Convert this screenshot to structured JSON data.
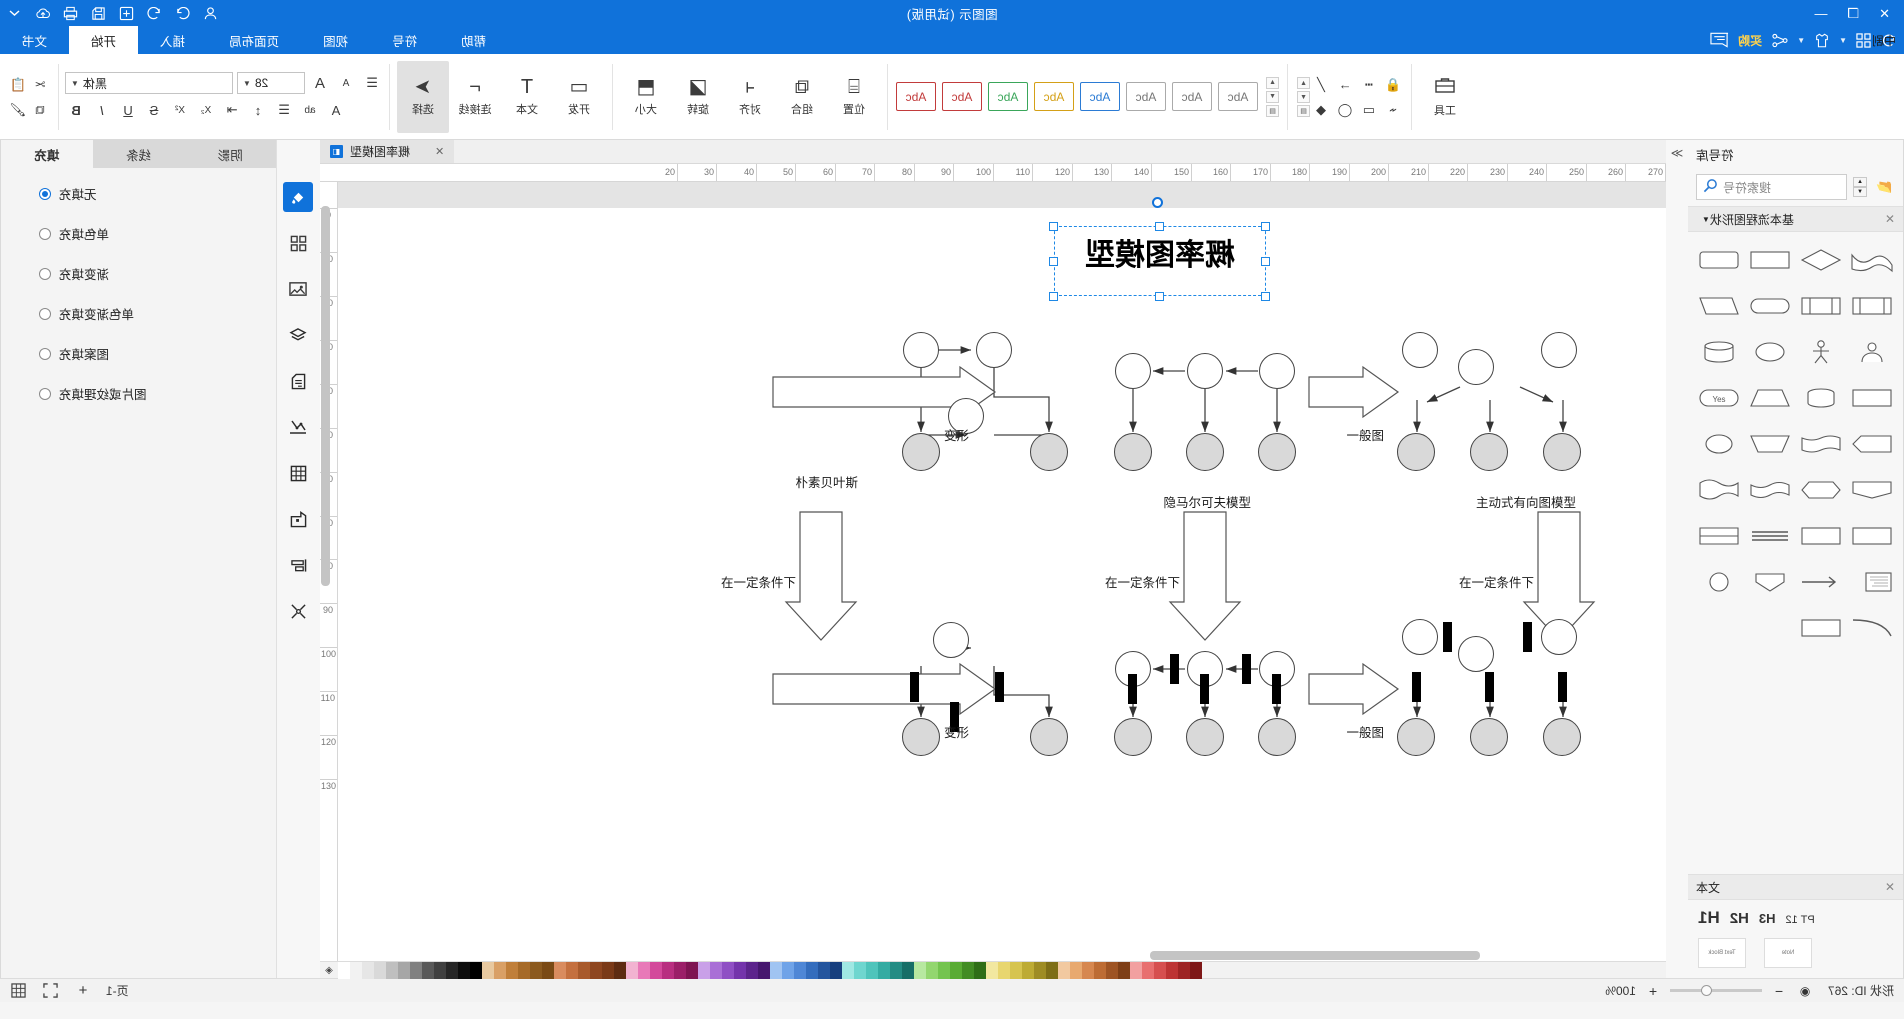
{
  "window": {
    "title": "图图示 (试用版)",
    "buttons": {
      "close": "✕",
      "restore": "❐",
      "minimize": "—"
    },
    "right_icons": [
      "chevron-down",
      "cloud-up",
      "print",
      "save",
      "plus",
      "undo",
      "redo",
      "user"
    ]
  },
  "quick_access": {
    "items": [
      {
        "name": "undo-arrow",
        "label": ""
      },
      {
        "name": "grid-apps",
        "label": ""
      },
      {
        "name": "theme-shirt",
        "label": ""
      },
      {
        "name": "mid-align",
        "label": "中剧"
      },
      {
        "name": "share-nodes",
        "label": ""
      },
      {
        "name": "buy-now",
        "label": "买购"
      },
      {
        "name": "comment",
        "label": ""
      }
    ]
  },
  "ribbon_tabs": [
    {
      "id": "file",
      "label": "文书",
      "active": false
    },
    {
      "id": "home",
      "label": "开始",
      "active": true
    },
    {
      "id": "insert",
      "label": "插入",
      "active": false
    },
    {
      "id": "layout",
      "label": "页面布局",
      "active": false
    },
    {
      "id": "view",
      "label": "视图",
      "active": false
    },
    {
      "id": "symbol",
      "label": "符号",
      "active": false
    },
    {
      "id": "help",
      "label": "帮助",
      "active": false
    }
  ],
  "ribbon": {
    "clipboard": {
      "cut": "✂",
      "copy": "⧉",
      "paste": "📋",
      "brush": "🖌"
    },
    "font": {
      "name_value": "黑体",
      "size_value": "28",
      "bold": "B",
      "italic": "I",
      "underline": "U",
      "strike": "S",
      "superscript": "X²",
      "subscript": "X₂",
      "grow": "A",
      "shrink": "A",
      "font_color": "A",
      "highlight": "ab",
      "align": "☰",
      "line_spacing": "↕",
      "indent": "⇥",
      "clear_format": "✕"
    },
    "styles": {
      "items": [
        "Abc",
        "Abc",
        "Abc",
        "Abc",
        "Abc",
        "Abc",
        "Abc",
        "Abc"
      ]
    },
    "arrange": [
      {
        "name": "size",
        "label": "大小",
        "icon": "⬒"
      },
      {
        "name": "rotate",
        "label": "旋转",
        "icon": "◪"
      },
      {
        "name": "align",
        "label": "对齐",
        "icon": "⫞"
      },
      {
        "name": "group",
        "label": "组合",
        "icon": "⧉"
      },
      {
        "name": "position",
        "label": "位置",
        "icon": "⌸"
      }
    ],
    "tools": [
      {
        "name": "select",
        "label": "选择",
        "icon": "➤",
        "selected": true
      },
      {
        "name": "connector",
        "label": "连接线",
        "icon": "⌐"
      },
      {
        "name": "text",
        "label": "文本",
        "icon": "T"
      },
      {
        "name": "pen",
        "label": "开发",
        "icon": "▭"
      }
    ],
    "shapes_tools": [
      {
        "name": "shape-rect",
        "icon": "▭"
      },
      {
        "name": "shape-ellipse",
        "icon": "◯"
      },
      {
        "name": "shape-fill",
        "icon": "◆"
      },
      {
        "name": "shape-line",
        "icon": "╱"
      },
      {
        "name": "shape-arrow",
        "icon": "→"
      },
      {
        "name": "shape-lock",
        "icon": "🔒"
      },
      {
        "name": "shape-dash",
        "icon": "┅"
      }
    ],
    "tools_group_label": "工具"
  },
  "format_panel": {
    "tabs": [
      {
        "id": "fill",
        "label": "填充",
        "active": true
      },
      {
        "id": "line",
        "label": "线条",
        "active": false
      },
      {
        "id": "shadow",
        "label": "阴影",
        "active": false
      }
    ],
    "fill_options": [
      {
        "label": "无填充",
        "selected": true
      },
      {
        "label": "单色填充",
        "selected": false
      },
      {
        "label": "渐变填充",
        "selected": false
      },
      {
        "label": "单色渐变填充",
        "selected": false
      },
      {
        "label": "图案填充",
        "selected": false
      },
      {
        "label": "图片或纹理填充",
        "selected": false
      }
    ]
  },
  "vertical_tools": [
    {
      "name": "fill-tool",
      "icon": "◆",
      "selected": true
    },
    {
      "name": "shapes-tool",
      "icon": "▦",
      "selected": false
    },
    {
      "name": "image-tool",
      "icon": "🖼",
      "selected": false
    },
    {
      "name": "layers-tool",
      "icon": "◈",
      "selected": false
    },
    {
      "name": "notes-tool",
      "icon": "▤",
      "selected": false
    },
    {
      "name": "chart-tool",
      "icon": "📈",
      "selected": false
    },
    {
      "name": "table-tool",
      "icon": "▦",
      "selected": false
    },
    {
      "name": "template-tool",
      "icon": "🗗",
      "selected": false
    },
    {
      "name": "align-tool",
      "icon": "⊢",
      "selected": false
    },
    {
      "name": "scatter-tool",
      "icon": "⁂",
      "selected": false
    }
  ],
  "stencil_panel": {
    "header": "符号库",
    "search_placeholder": "搜索符号",
    "library_title": "基本流程图形状",
    "collapse_icon": "≫",
    "close_icon": "✕",
    "text_section_title": "文本",
    "text_styles": [
      "H1",
      "H2",
      "H3",
      "PT 12"
    ],
    "text_thumbs": [
      "Text Block",
      "Note"
    ],
    "shapes": [
      "wave",
      "diamond",
      "rectangle",
      "rounded-rect",
      "split-rect",
      "banner",
      "stadium",
      "parallelogram",
      "person",
      "actor",
      "circle",
      "cylinder",
      "rect2",
      "cylinder2",
      "trapezoid",
      "yes-badge",
      "pentagon-arrow",
      "tape",
      "trapezoid2",
      "oval",
      "flag",
      "hexagon",
      "wave2",
      "wave3",
      "rect3",
      "rect4",
      "lines",
      "ribbon",
      "note-text",
      "arrow-left",
      "shield",
      "circle2",
      "curve",
      "rect5"
    ]
  },
  "document": {
    "tab_title": "概率图模型",
    "tab_close": "✕",
    "file_icon": "□"
  },
  "rulers": {
    "h_ticks": [
      "270",
      "260",
      "250",
      "240",
      "230",
      "220",
      "210",
      "200",
      "190",
      "180",
      "170",
      "160",
      "150",
      "140",
      "130",
      "120",
      "110",
      "100",
      "90",
      "80",
      "70",
      "60",
      "50",
      "40",
      "30",
      "20"
    ],
    "v_ticks": [
      "0",
      "10",
      "20",
      "30",
      "40",
      "50",
      "60",
      "70",
      "80",
      "90",
      "100",
      "110",
      "120",
      "130"
    ]
  },
  "canvas": {
    "title_shape": "概率图模型",
    "columns": [
      {
        "id": "right",
        "label": "朴素贝叶斯",
        "bottom_label": "在一定条件下"
      },
      {
        "id": "middle",
        "label": "隐马尔可夫模型",
        "bottom_label": "在一定条件下"
      },
      {
        "id": "left",
        "label": "主动式有向图模型",
        "bottom_label": "在一定条件下"
      }
    ],
    "arrow_labels": [
      {
        "id": "a1",
        "label": "变形"
      },
      {
        "id": "a2",
        "label": "一般图"
      },
      {
        "id": "a3",
        "label": "变形"
      },
      {
        "id": "a4",
        "label": "一般图"
      }
    ]
  },
  "status_bar": {
    "shape_id_label": "形状 ID: 267",
    "page_label": "页-1",
    "zoom_label": "100%",
    "zoom_out": "−",
    "zoom_in": "+",
    "fit_icon": "◉",
    "fullscreen_icon": "⛶",
    "grid_icon": "▤",
    "add_page": "+"
  },
  "colors": {
    "brand": "#1072da",
    "panel": "#f4f4f4",
    "node_fill": "#d9d9d9",
    "selection": "#1e88e5",
    "accent_yellow": "#ffd34d"
  },
  "palette_swatches": [
    "#ffffff",
    "#f2f2f2",
    "#e6e6e6",
    "#d9d9d9",
    "#bfbfbf",
    "#a6a6a6",
    "#808080",
    "#595959",
    "#404040",
    "#262626",
    "#0d0d0d",
    "#000000",
    "#e8c9a0",
    "#d9a066",
    "#c07f3a",
    "#a66a28",
    "#8b5a1f",
    "#7a4a15",
    "#d98c5f",
    "#c4703f",
    "#a85a2c",
    "#8e4620",
    "#7a3a18",
    "#5e2c12",
    "#f2b3d1",
    "#e879b8",
    "#d3499b",
    "#b82f80",
    "#9b1f68",
    "#7e1452",
    "#c9a0e8",
    "#a96fd6",
    "#8f4fc4",
    "#7434ab",
    "#5c248c",
    "#46176e",
    "#a0c4f2",
    "#6fa3e8",
    "#4f87d6",
    "#346dbd",
    "#24559e",
    "#173f7e",
    "#a0e8e3",
    "#6fd6cf",
    "#4fc4bb",
    "#34aba2",
    "#248c84",
    "#176e67",
    "#b7e8a0",
    "#93d66f",
    "#74c44f",
    "#59ab34",
    "#428c24",
    "#2f6e17",
    "#f2e8a0",
    "#e8d66f",
    "#d6c44f",
    "#bdab34",
    "#9e8c24",
    "#7e6e17",
    "#f2c9a0",
    "#e8a96f",
    "#d6874f",
    "#bd6c34",
    "#9e5424",
    "#7e3f17",
    "#f2a0a0",
    "#e86f6f",
    "#d64f4f",
    "#bd3434",
    "#9e2424",
    "#7e1717"
  ]
}
